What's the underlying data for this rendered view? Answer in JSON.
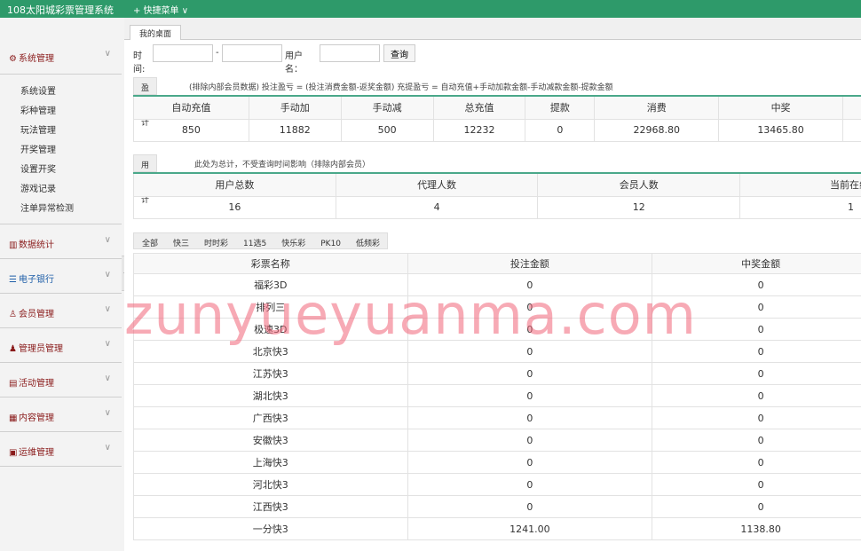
{
  "app": {
    "title": "108太阳城彩票管理系统",
    "quick_menu": "+ 快捷菜单 ∨"
  },
  "sidebar": {
    "groups": [
      {
        "label": "系统管理",
        "icon": "gear-icon"
      },
      {
        "label": "数据统计",
        "icon": "bar-chart-icon"
      },
      {
        "label": "电子银行",
        "icon": "list-icon"
      },
      {
        "label": "会员管理",
        "icon": "user-icon"
      },
      {
        "label": "管理员管理",
        "icon": "admin-icon"
      },
      {
        "label": "活动管理",
        "icon": "gift-icon"
      },
      {
        "label": "内容管理",
        "icon": "document-icon"
      },
      {
        "label": "运维管理",
        "icon": "server-icon"
      }
    ],
    "submenu": [
      "系统设置",
      "彩种管理",
      "玩法管理",
      "开奖管理",
      "设置开奖",
      "游戏记录",
      "注单异常检测"
    ]
  },
  "tabs": {
    "desktop": "我的桌面"
  },
  "filter": {
    "time_label": "时间:",
    "dash": "-",
    "username_label": "用户名：",
    "query_button": "查询"
  },
  "profit": {
    "label": "盈亏统计",
    "note": "(排除内部会员数据)  投注盈亏 = (投注消费金额-返奖金额)    充提盈亏 = 自动充值+手动加款金额-手动减款金额-提款金额",
    "headers": [
      "自动充值",
      "手动加",
      "手动减",
      "总充值",
      "提款",
      "消费",
      "中奖"
    ],
    "values": [
      "850",
      "11882",
      "500",
      "12232",
      "0",
      "22968.80",
      "13465.80"
    ]
  },
  "users": {
    "label": "用户统计",
    "note": "此处为总计，不受查询时间影响（排除内部会员）",
    "headers": [
      "用户总数",
      "代理人数",
      "会员人数",
      "当前在线"
    ],
    "values": [
      "16",
      "4",
      "12",
      "1"
    ]
  },
  "lottery": {
    "tabs": [
      "全部",
      "快三",
      "时时彩",
      "11选5",
      "快乐彩",
      "PK10",
      "低频彩"
    ],
    "headers": [
      "彩票名称",
      "投注金额",
      "中奖金额"
    ],
    "rows": [
      [
        "福彩3D",
        "0",
        "0"
      ],
      [
        "排列三",
        "0",
        "0"
      ],
      [
        "极速3D",
        "0",
        "0"
      ],
      [
        "北京快3",
        "0",
        "0"
      ],
      [
        "江苏快3",
        "0",
        "0"
      ],
      [
        "湖北快3",
        "0",
        "0"
      ],
      [
        "广西快3",
        "0",
        "0"
      ],
      [
        "安徽快3",
        "0",
        "0"
      ],
      [
        "上海快3",
        "0",
        "0"
      ],
      [
        "河北快3",
        "0",
        "0"
      ],
      [
        "江西快3",
        "0",
        "0"
      ],
      [
        "一分快3",
        "1241.00",
        "1138.80"
      ]
    ]
  },
  "watermark": "zunyueyuanma.com"
}
